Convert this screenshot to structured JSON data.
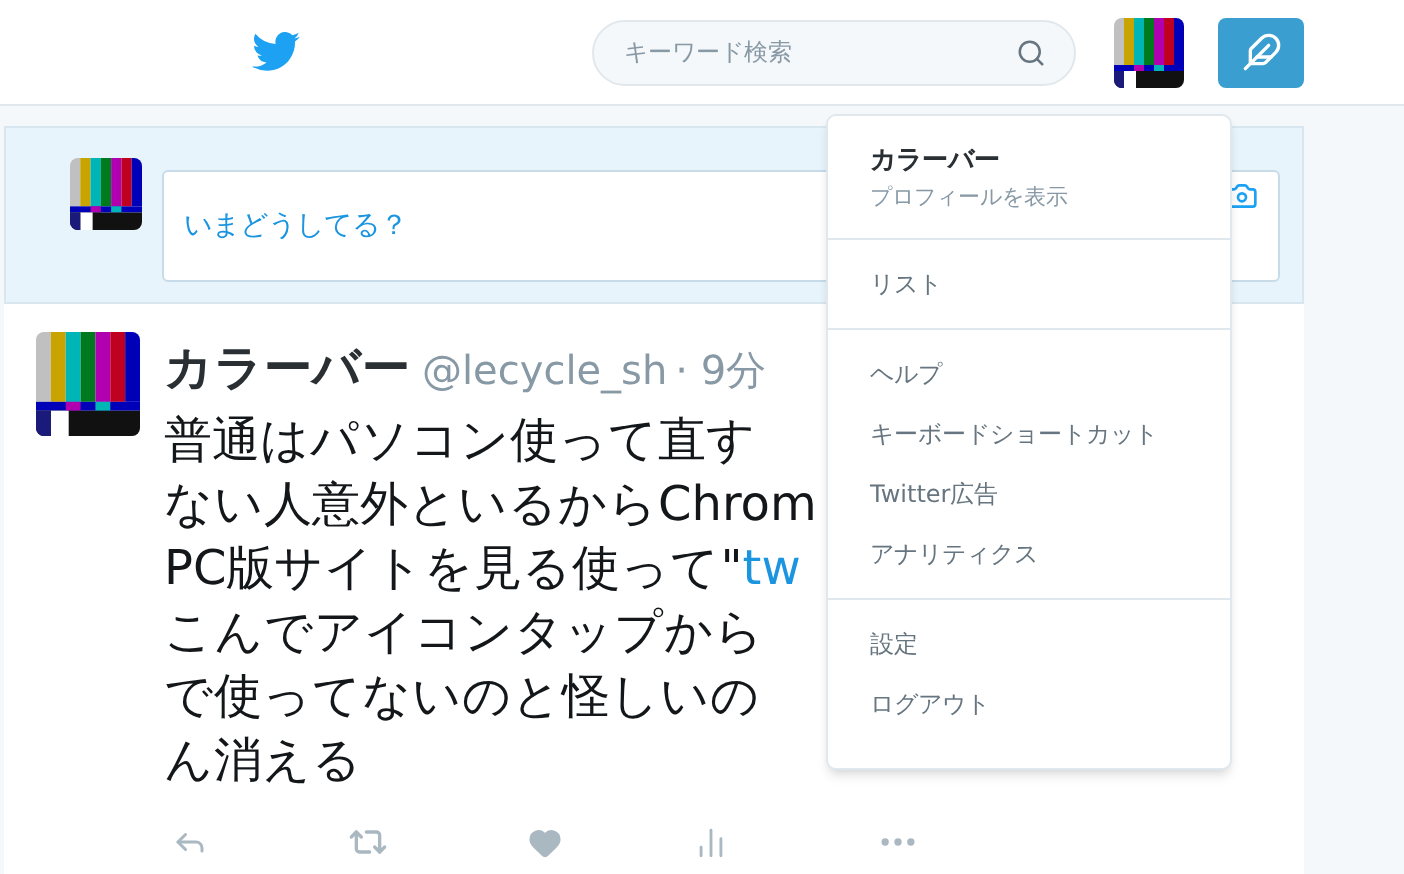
{
  "header": {
    "search": {
      "placeholder": "キーワード検索"
    }
  },
  "compose": {
    "placeholder": "いまどうしてる？"
  },
  "tweet": {
    "name": "カラーバー",
    "handle": "@lecycle_sh",
    "time": "· 9分",
    "lines": [
      {
        "text": "普通はパソコン使って直す"
      },
      {
        "text": "ない人意外といるからChrom"
      },
      {
        "text": "PC版サイトを見る使って\"",
        "link": "tw"
      },
      {
        "text": "こんでアイコンタップから"
      },
      {
        "text": "で使ってないのと怪しいの"
      },
      {
        "text": "ん消える"
      }
    ]
  },
  "menu": {
    "profile_name": "カラーバー",
    "profile_link": "プロフィールを表示",
    "groups": [
      [
        "リスト"
      ],
      [
        "ヘルプ",
        "キーボードショートカット",
        "Twitter広告",
        "アナリティクス"
      ],
      [
        "設定",
        "ログアウト"
      ]
    ]
  }
}
